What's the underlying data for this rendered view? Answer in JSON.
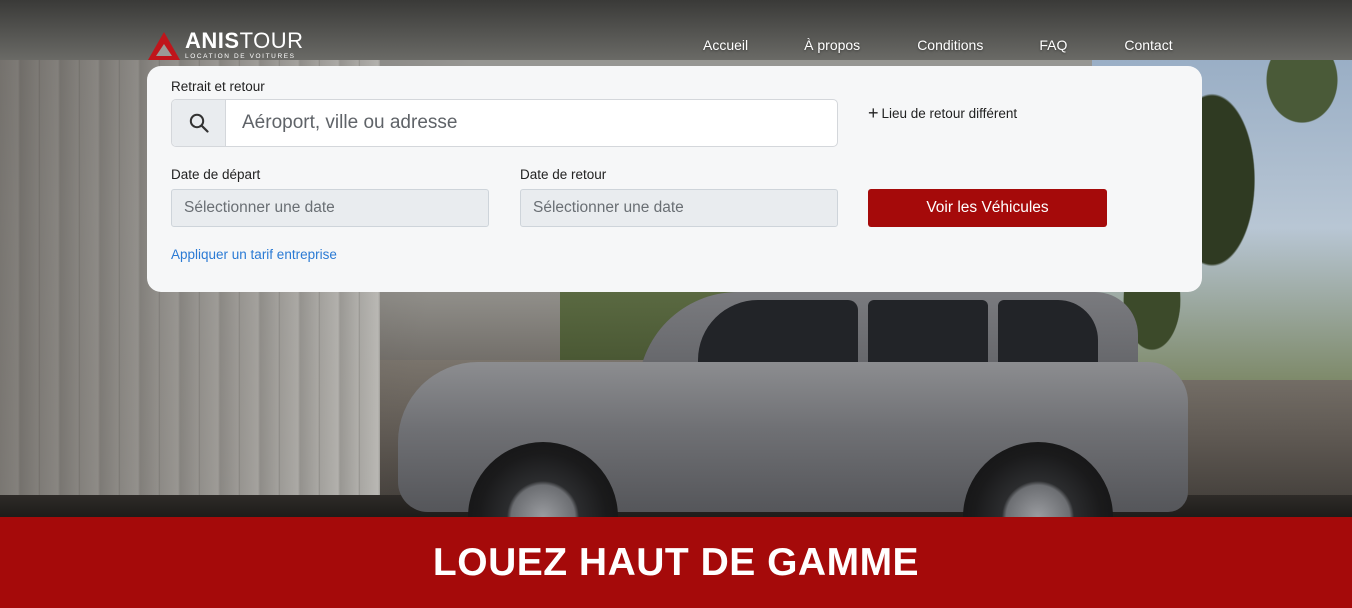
{
  "brand": {
    "name_bold": "ANIS",
    "name_light": "TOUR",
    "tagline": "LOCATION DE VOITURES",
    "accent_color": "#c0151b"
  },
  "nav": {
    "items": [
      {
        "label": "Accueil"
      },
      {
        "label": "À propos"
      },
      {
        "label": "Conditions"
      },
      {
        "label": "FAQ"
      },
      {
        "label": "Contact"
      }
    ]
  },
  "search": {
    "location_label": "Retrait et retour",
    "location_placeholder": "Aéroport, ville ou adresse",
    "location_icon": "search-icon",
    "different_return": "Lieu de retour différent",
    "departure_label": "Date de départ",
    "departure_placeholder": "Sélectionner une date",
    "return_label": "Date de retour",
    "return_placeholder": "Sélectionner une date",
    "submit_label": "Voir les Véhicules",
    "corporate_link": "Appliquer un tarif entreprise",
    "primary_color": "#a50a0a",
    "link_color": "#2a7ad4"
  },
  "banner": {
    "headline": "LOUEZ HAUT DE GAMME"
  }
}
